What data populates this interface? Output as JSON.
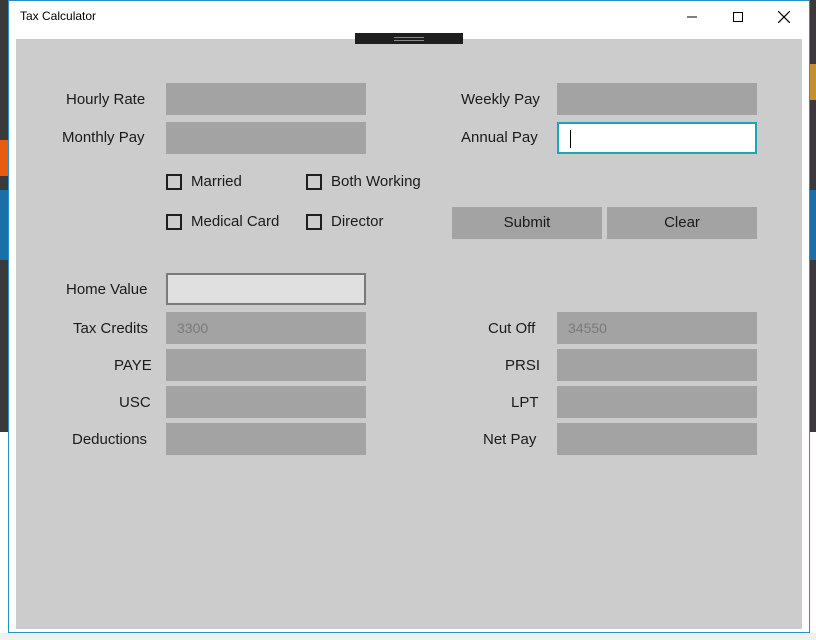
{
  "window": {
    "title": "Tax Calculator"
  },
  "labels": {
    "hourly_rate": "Hourly Rate",
    "monthly_pay": "Monthly Pay",
    "weekly_pay": "Weekly Pay",
    "annual_pay": "Annual Pay",
    "home_value": "Home Value",
    "tax_credits": "Tax Credits",
    "paye": "PAYE",
    "usc": "USC",
    "deductions": "Deductions",
    "cut_off": "Cut Off",
    "prsi": "PRSI",
    "lpt": "LPT",
    "net_pay": "Net Pay"
  },
  "fields": {
    "hourly_rate": "",
    "monthly_pay": "",
    "weekly_pay": "",
    "annual_pay": "",
    "home_value": "",
    "tax_credits_placeholder": "3300",
    "cut_off_placeholder": "34550",
    "paye": "",
    "prsi": "",
    "usc": "",
    "lpt": "",
    "deductions": "",
    "net_pay": ""
  },
  "checkboxes": {
    "married": "Married",
    "both_working": "Both Working",
    "medical_card": "Medical Card",
    "director": "Director"
  },
  "buttons": {
    "submit": "Submit",
    "clear": "Clear"
  },
  "colors": {
    "content_bg": "#cccccc",
    "field_bg": "#a3a3a3",
    "focus_border": "#1ba6b5",
    "window_border": "#2b8fc9"
  }
}
